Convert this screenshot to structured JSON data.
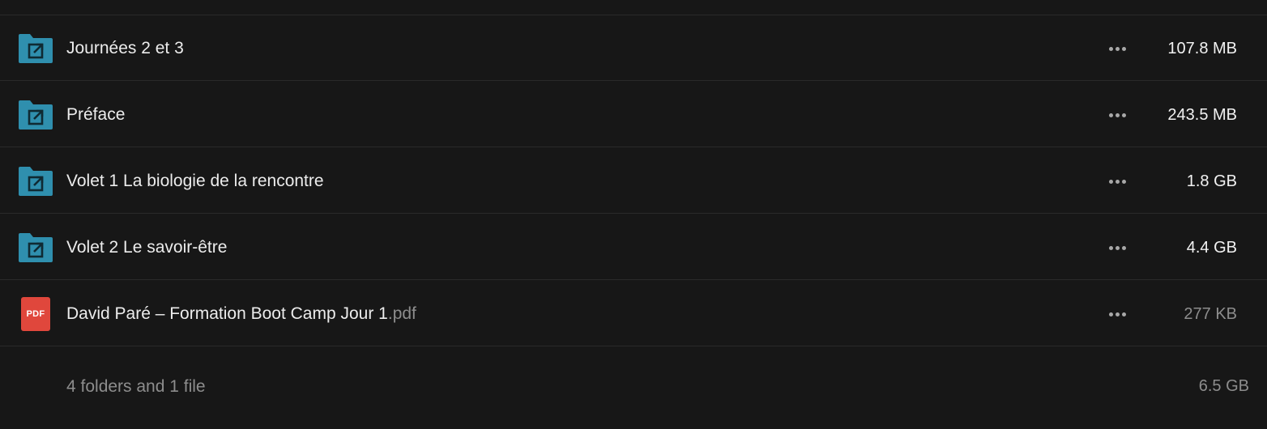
{
  "items": [
    {
      "name": "Journées 2 et 3",
      "ext": "",
      "type": "shared-folder",
      "size": "107.8 MB"
    },
    {
      "name": "Préface",
      "ext": "",
      "type": "shared-folder",
      "size": "243.5 MB"
    },
    {
      "name": "Volet 1 La biologie de la rencontre",
      "ext": "",
      "type": "shared-folder",
      "size": "1.8 GB"
    },
    {
      "name": "Volet 2 Le savoir-être",
      "ext": "",
      "type": "shared-folder",
      "size": "4.4 GB"
    },
    {
      "name": "David Paré – Formation Boot Camp Jour 1",
      "ext": ".pdf",
      "type": "pdf",
      "size": "277 KB",
      "badge": "PDF"
    }
  ],
  "footer": {
    "summary": "4 folders and 1 file",
    "total": "6.5 GB"
  },
  "colors": {
    "background": "#171717",
    "folder_icon": "#2f8fae",
    "pdf_badge": "#e0473c"
  },
  "icons": {
    "folder": "shared-folder-icon",
    "file": "pdf-file-icon",
    "menu": "more-options-icon"
  }
}
